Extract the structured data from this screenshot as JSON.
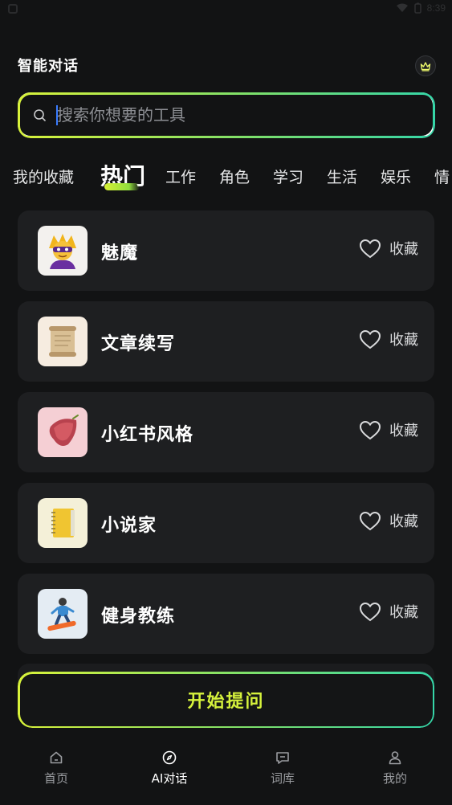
{
  "status_bar": {
    "time": "8:39",
    "icons": [
      "wifi-icon",
      "battery-icon"
    ]
  },
  "header": {
    "title": "智能对话",
    "crown_icon": "crown-icon"
  },
  "search": {
    "placeholder": "搜索你想要的工具",
    "value": ""
  },
  "tabs": [
    {
      "label": "我的收藏",
      "active": false
    },
    {
      "label": "热门",
      "active": true
    },
    {
      "label": "工作",
      "active": false
    },
    {
      "label": "角色",
      "active": false
    },
    {
      "label": "学习",
      "active": false
    },
    {
      "label": "生活",
      "active": false
    },
    {
      "label": "娱乐",
      "active": false
    },
    {
      "label": "情",
      "active": false
    }
  ],
  "tools": [
    {
      "name": "魅魔",
      "icon": "villain-emoji-icon",
      "fav_label": "收藏"
    },
    {
      "name": "文章续写",
      "icon": "scroll-emoji-icon",
      "fav_label": "收藏"
    },
    {
      "name": "小红书风格",
      "icon": "sweet-potato-emoji-icon",
      "fav_label": "收藏"
    },
    {
      "name": "小说家",
      "icon": "notebook-emoji-icon",
      "fav_label": "收藏"
    },
    {
      "name": "健身教练",
      "icon": "snowboarder-emoji-icon",
      "fav_label": "收藏"
    }
  ],
  "start_button": {
    "label": "开始提问"
  },
  "bottom_nav": [
    {
      "label": "首页",
      "icon": "home-icon",
      "active": false
    },
    {
      "label": "AI对话",
      "icon": "compass-icon",
      "active": true
    },
    {
      "label": "词库",
      "icon": "message-icon",
      "active": false
    },
    {
      "label": "我的",
      "icon": "user-icon",
      "active": false
    }
  ],
  "colors": {
    "background": "#121314",
    "card": "#1e1f21",
    "accent_start": "#d8f23a",
    "accent_end": "#35d6a8"
  }
}
